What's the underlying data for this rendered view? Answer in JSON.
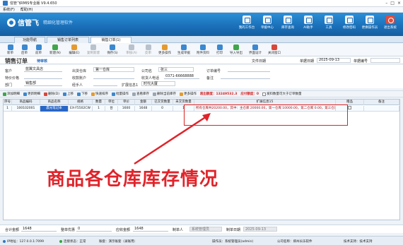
{
  "window": {
    "title": "信管飞RMIS专业版 V9.4.650"
  },
  "menu": [
    "系统(F)",
    "帮助(H)"
  ],
  "banner": {
    "brand": "信管飞",
    "slogan": "精细化管理软件",
    "icons": [
      {
        "label": "我的工作台",
        "icon": "desk-icon"
      },
      {
        "label": "单据中心",
        "icon": "doc-center-icon"
      },
      {
        "label": "库存查询",
        "icon": "stock-query-icon"
      },
      {
        "label": "AI助手",
        "icon": "ai-icon"
      },
      {
        "label": "工具",
        "icon": "tools-icon"
      },
      {
        "label": "修改密码",
        "icon": "password-icon"
      },
      {
        "label": "更换操作员",
        "icon": "switch-user-icon"
      },
      {
        "label": "退出系统",
        "icon": "exit-icon"
      }
    ]
  },
  "tabs": [
    "功能导航",
    "销售订单列表",
    "销售订单(1)"
  ],
  "toolbar": [
    {
      "label": "新单",
      "icon": "new-icon"
    },
    {
      "label": "后单",
      "icon": "next-icon"
    },
    {
      "label": "前单",
      "icon": "prev-icon"
    },
    {
      "label": "新建(N)",
      "icon": "create-icon"
    },
    {
      "label": "编辑(E)",
      "icon": "edit-icon"
    },
    {
      "label": "复制新建",
      "icon": "copy-icon"
    },
    {
      "label": "保存(S)",
      "icon": "save-icon"
    },
    {
      "label": "审核(A)",
      "icon": "audit-icon"
    },
    {
      "label": "反审",
      "icon": "unaudit-icon"
    },
    {
      "label": "更多操作",
      "icon": "more-icon"
    },
    {
      "label": "生成单据",
      "icon": "generate-icon"
    },
    {
      "label": "附件资料",
      "icon": "attach-icon"
    },
    {
      "label": "打印",
      "icon": "print-icon"
    },
    {
      "label": "导入导出",
      "icon": "import-export-icon"
    },
    {
      "label": "界面设计",
      "icon": "design-icon"
    },
    {
      "label": "关闭窗口",
      "icon": "close-window-icon"
    }
  ],
  "doc": {
    "title": "销售订单",
    "status": "待审核",
    "date_label": "单据日期",
    "date": "2025-09-13",
    "no_label": "单据编号",
    "no": "",
    "extra_label": "文件日期"
  },
  "form": {
    "customer_label": "客户",
    "customer": "蓝翼文具店",
    "warehouse_label": "出货仓库",
    "warehouse": "第一仓库",
    "company_label": "公司名",
    "company": "张三",
    "orderno_label": "订单编号",
    "specialist_label": "特价价格",
    "collector_label": "收款账户",
    "contact_label": "收货人电话",
    "contact": "0371-66668888",
    "remark_label": "备注",
    "dept_label": "部门",
    "dept": "销售部",
    "handler_label": "经手人",
    "ext_label": "扩展信息1",
    "ext": "时代大厦"
  },
  "gridtools": {
    "items": [
      {
        "label": "添加明细",
        "icon": "add-icon"
      },
      {
        "label": "更新明细",
        "icon": "update-icon"
      },
      {
        "label": "删除(D)",
        "icon": "delete-icon"
      },
      {
        "label": "上移",
        "icon": "up-icon"
      },
      {
        "label": "下移",
        "icon": "down-icon"
      },
      {
        "label": "快速排序",
        "icon": "sort-icon"
      },
      {
        "label": "批量操作",
        "icon": "batch-icon"
      },
      {
        "label": "查看库存",
        "icon": "stock-icon"
      },
      {
        "label": "删除当前库存",
        "icon": "clear-stock-icon"
      },
      {
        "label": "更多操作",
        "icon": "more-icon"
      }
    ],
    "alert1": "超出额度：13249532.3",
    "alert2": "应付额度：0",
    "check_label": "发料数量可大于订单数量"
  },
  "grid": {
    "columns": [
      "序号",
      "商品编码",
      "商品名称",
      "规格",
      "数量",
      "单位",
      "单价",
      "金额",
      "已交货数量",
      "未交货数量",
      "扩展信息15",
      "赠品",
      "备注"
    ],
    "rows": [
      {
        "seq": "1",
        "code": "100102001",
        "name": "晨光笔记本",
        "spec": "EX-F5502CW",
        "qty": "1",
        "unit": "台",
        "price": "1600",
        "amount": "1648",
        "delivered": "0",
        "undelivered": "1",
        "stock": "所有仓库共20200.00，其中：主仓库 20000.00，第一仓库 10000.00，第二仓库 0.00，第三仓库 0.00",
        "gift": "",
        "remark": ""
      }
    ]
  },
  "callout": "商品各仓库库存情况",
  "footer": {
    "total_label": "合计金额",
    "total": "1648",
    "discount_label": "整单优惠",
    "discount": "0",
    "received_label": "应收金额",
    "received": "1648",
    "maker_label": "制单人",
    "maker": "系统管理员",
    "date_label": "制单日期",
    "date": "2025-09-13"
  },
  "status": {
    "ip": "IP地址：127.0.0.1:7099",
    "conn": "连接状态：正常",
    "account": "账套：演示账套（录账用）",
    "operator": "操作员：系统管理员(admin)",
    "company": "公司名称：郑州长乐软件",
    "info": "技术支持：技术支持"
  },
  "colors": {
    "banner": "#1a6fb8",
    "alert": "#d42222",
    "callout": "#e0232a",
    "selection": "#2866c6"
  }
}
